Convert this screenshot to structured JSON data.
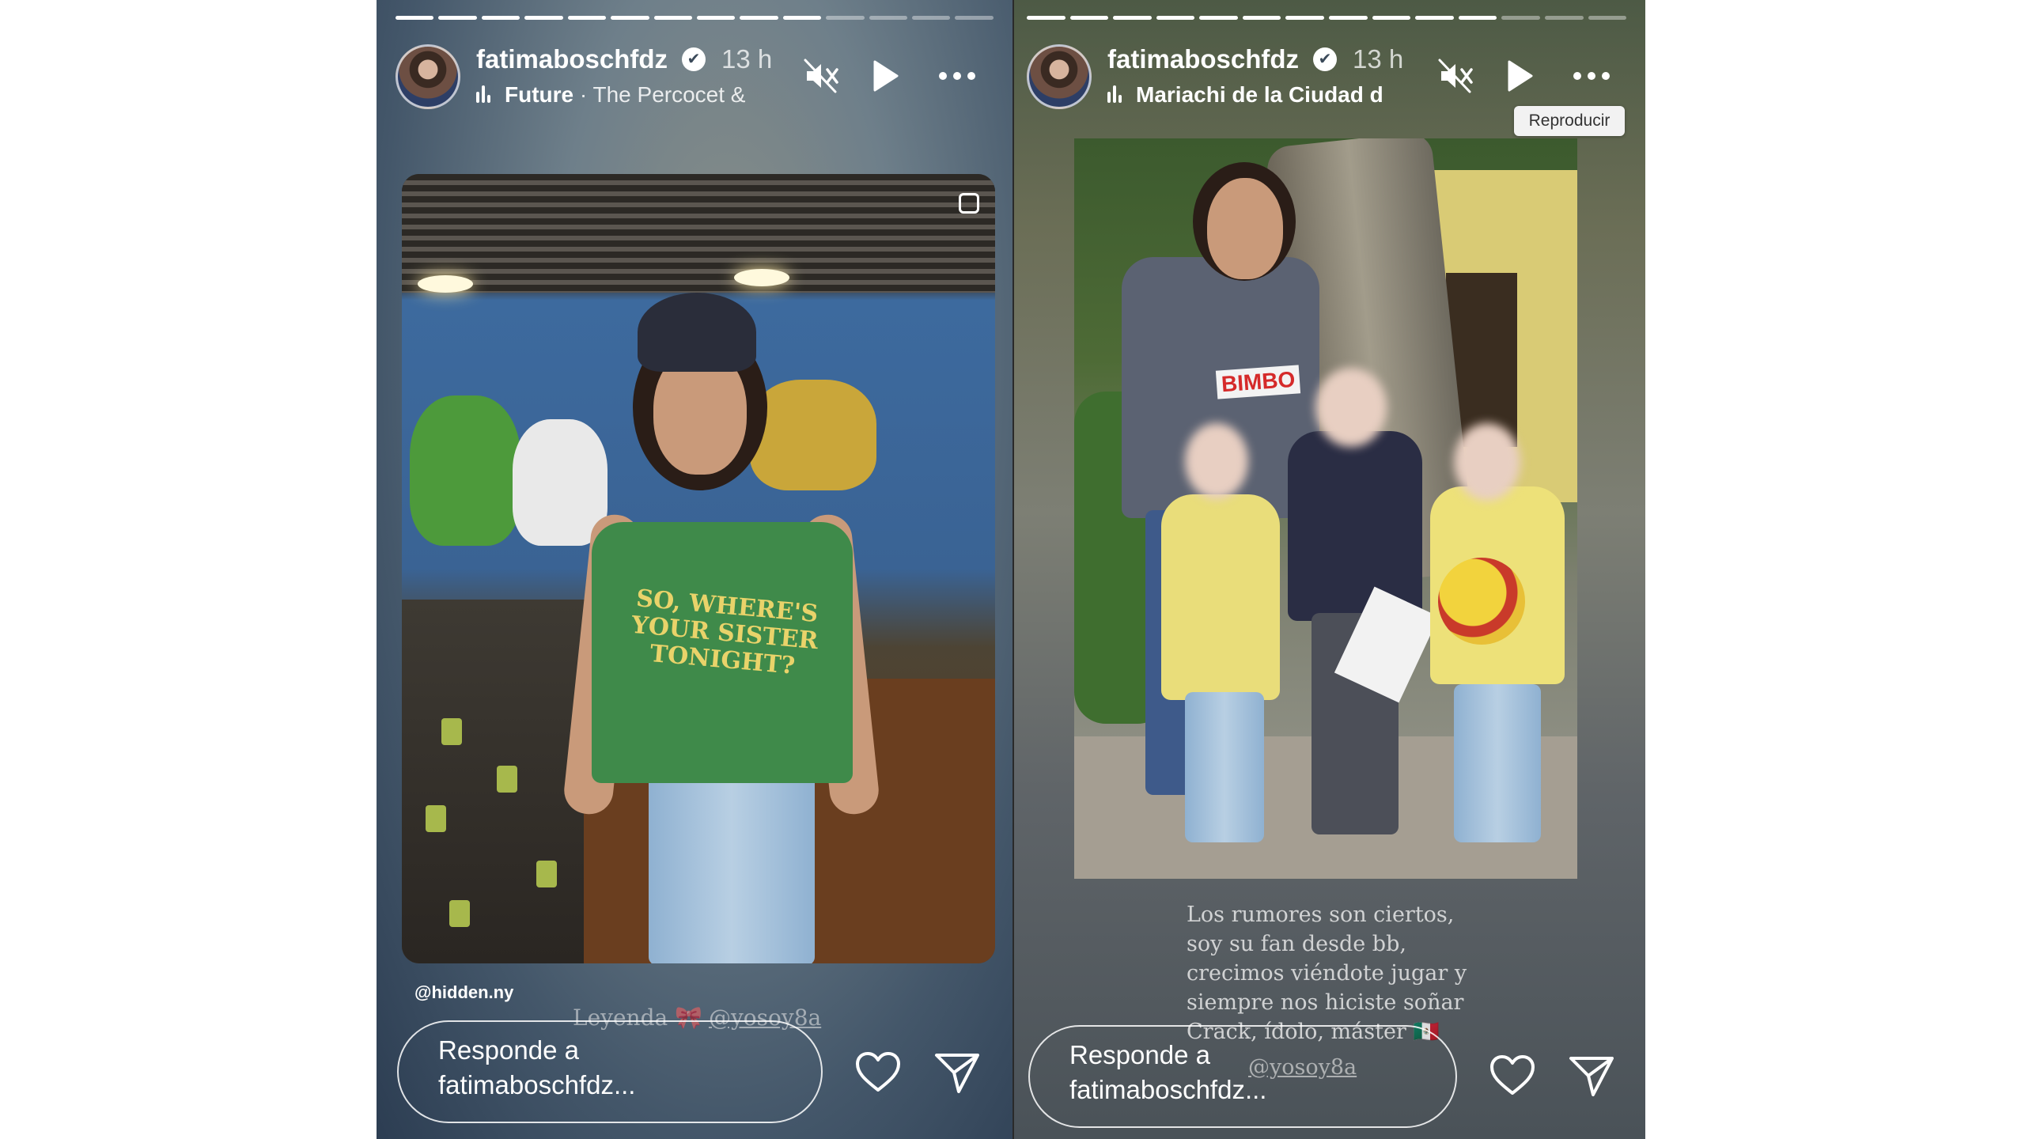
{
  "stories": [
    {
      "username": "fatimaboschfdz",
      "verified_glyph": "✔",
      "time": "13 h",
      "music_artist": "Future",
      "music_separator": " · ",
      "music_title": "The Percocet &",
      "mention": "@hidden.ny",
      "shirt_text": "SO, WHERE'S\nYOUR SISTER\nTONIGHT?",
      "caption_text": "Leyenda 🎀",
      "caption_tag": "@yosoy8a",
      "reply_placeholder": "Responde a\nfatimaboschfdz...",
      "progress": {
        "total": 14,
        "completed": 10
      }
    },
    {
      "username": "fatimaboschfdz",
      "verified_glyph": "✔",
      "time": "13 h",
      "music_artist": "Mariachi de la Ciudad d",
      "music_separator": "",
      "music_title": "",
      "photo_text": "BIMBO",
      "caption_lines": [
        "Los rumores son ciertos,",
        "soy su fan desde bb,",
        "crecimos viéndote jugar y",
        "siempre nos hiciste soñar",
        "Crack, ídolo, máster 🇲🇽"
      ],
      "caption_tag": "@yosoy8a",
      "reply_placeholder": "Responde a\nfatimaboschfdz...",
      "progress": {
        "total": 14,
        "completed": 11
      }
    }
  ],
  "tooltip": "Reproducir",
  "icons": [
    "mute-icon",
    "play-icon",
    "more-icon",
    "heart-icon",
    "send-icon",
    "music-bars-icon",
    "verified-icon"
  ],
  "colors": {
    "white": "#ffffff",
    "tooltip_bg": "#f2f2f2"
  }
}
